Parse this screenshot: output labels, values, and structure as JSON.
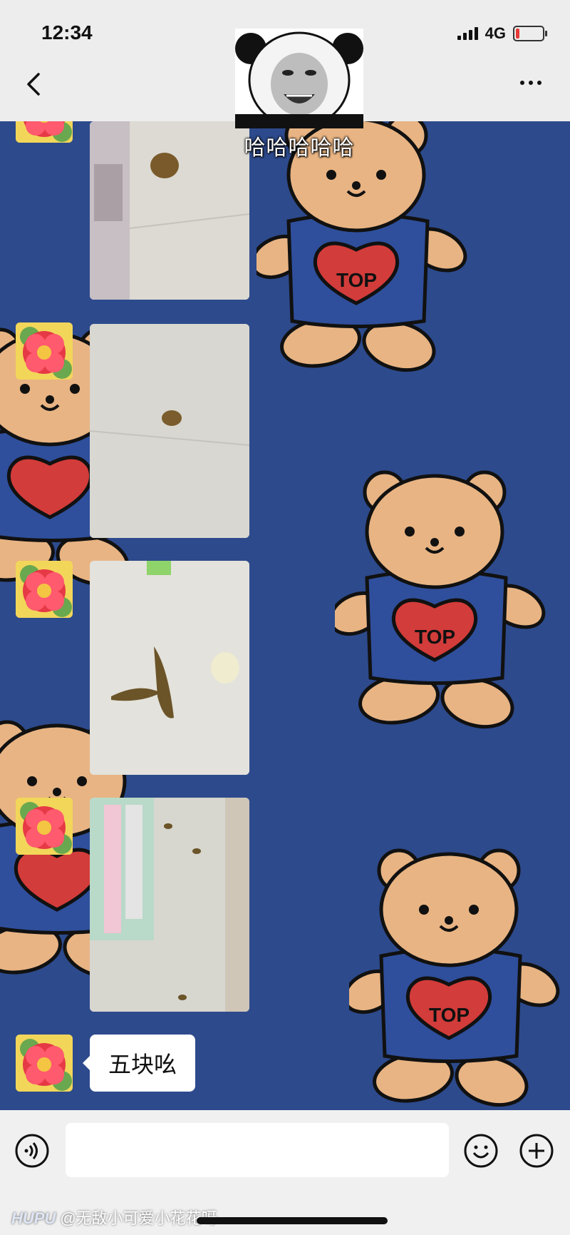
{
  "status_bar": {
    "time": "12:34",
    "network": "4G"
  },
  "header": {
    "title_hint": "花"
  },
  "sticker": {
    "caption": "哈哈哈哈哈"
  },
  "messages": [
    {
      "type": "image",
      "description": "floor photo"
    },
    {
      "type": "image",
      "description": "floor photo"
    },
    {
      "type": "image",
      "description": "floor photo"
    },
    {
      "type": "image",
      "description": "floor photo"
    },
    {
      "type": "text",
      "text": "五块吆"
    }
  ],
  "wallpaper": {
    "shirt_text": "TOP"
  },
  "watermark": {
    "brand": "HUPU",
    "text": "@无敌小可爱小花花呀"
  },
  "colors": {
    "bg_blue": "#2d4a8c",
    "bear": "#e8b483",
    "shirt": "#2f4f9c",
    "heart": "#d23c3a"
  }
}
